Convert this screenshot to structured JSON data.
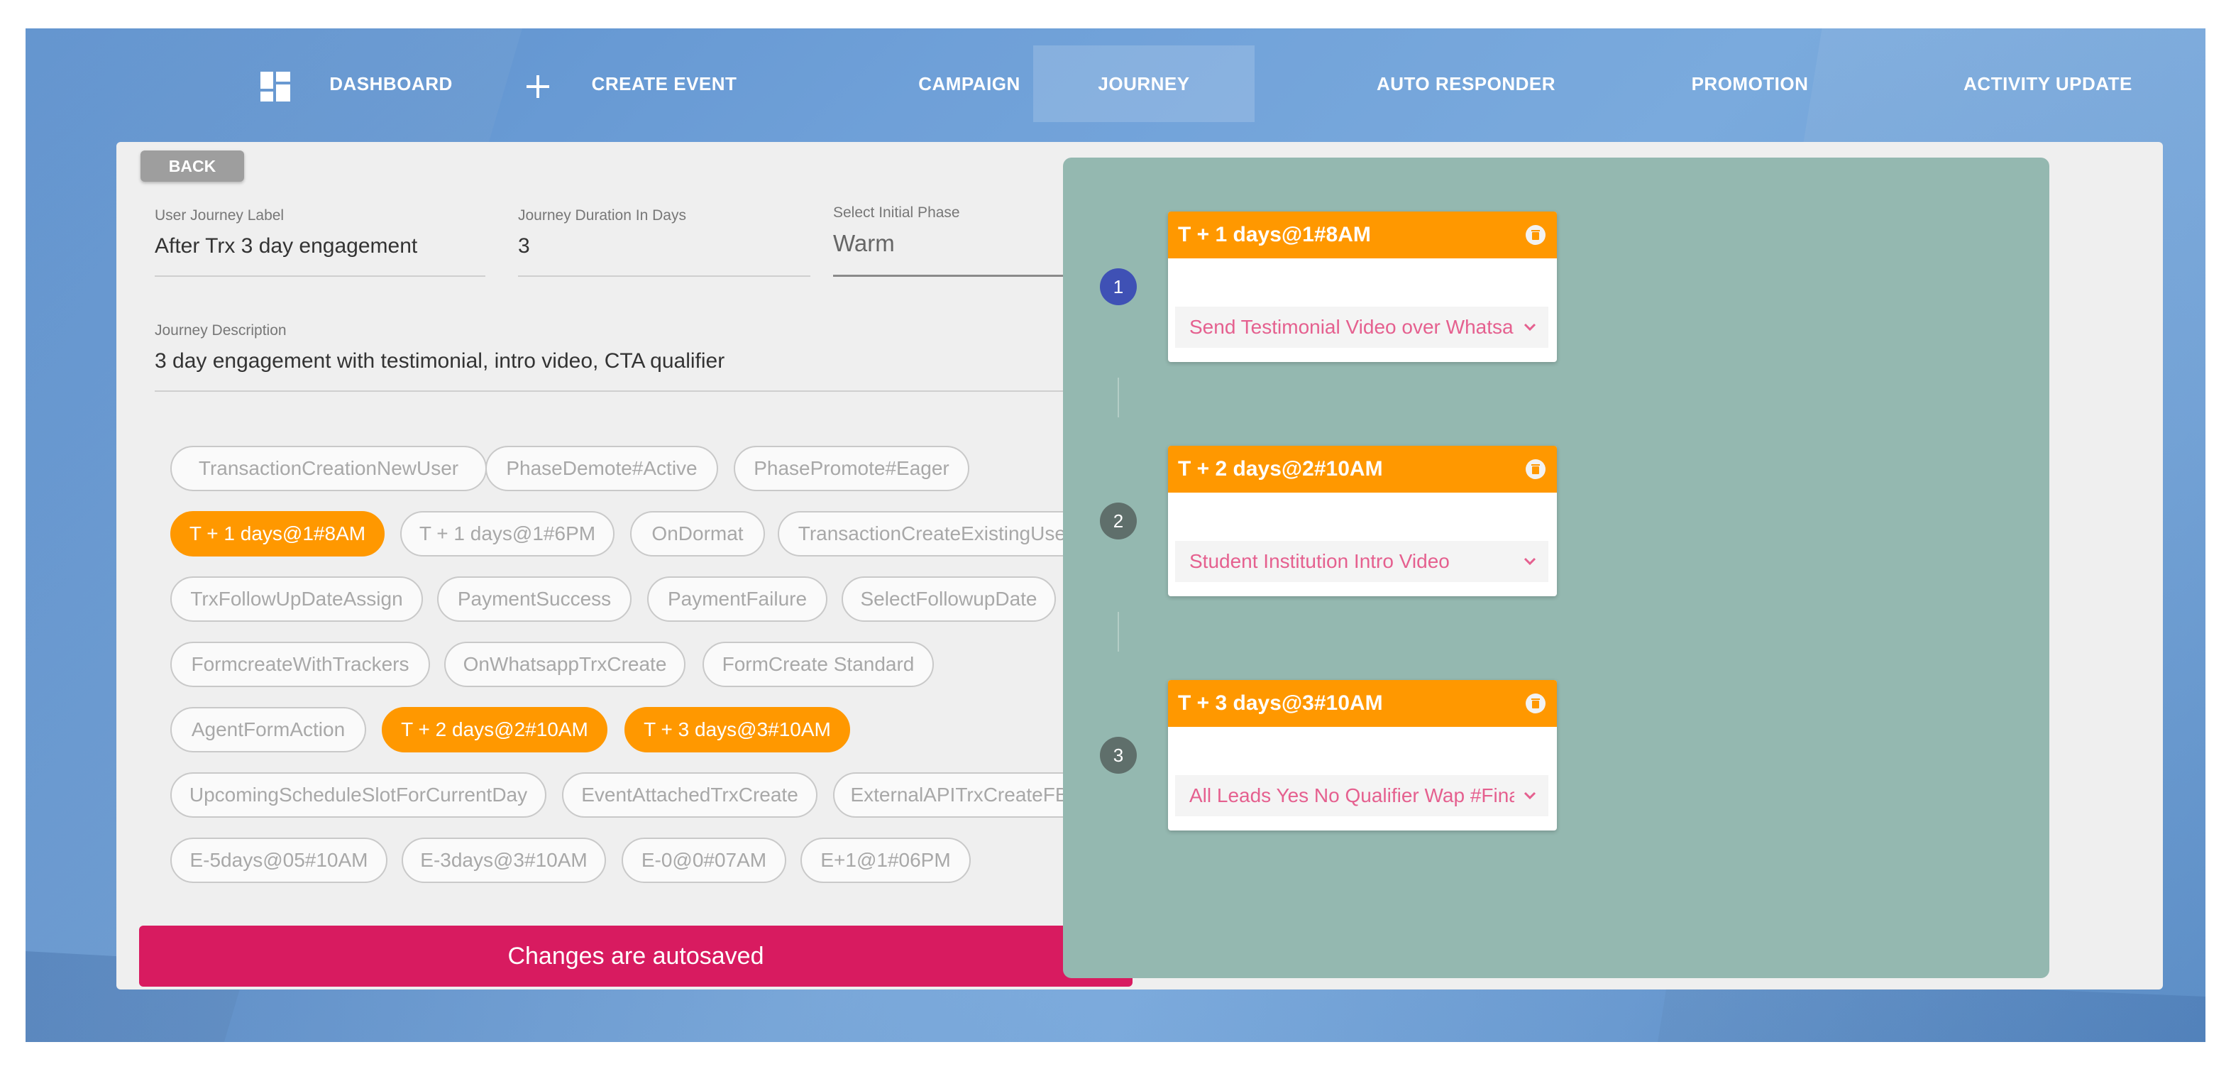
{
  "nav": {
    "items": [
      {
        "key": "dashboard",
        "label": "DASHBOARD",
        "icon": "dashboard-grid-icon"
      },
      {
        "key": "create-event",
        "label": "CREATE EVENT",
        "icon": "plus-icon"
      },
      {
        "key": "campaign",
        "label": "CAMPAIGN"
      },
      {
        "key": "journey",
        "label": "JOURNEY",
        "active": true
      },
      {
        "key": "auto-responder",
        "label": "AUTO RESPONDER"
      },
      {
        "key": "promotion",
        "label": "PROMOTION"
      },
      {
        "key": "activity-update",
        "label": "ACTIVITY UPDATE"
      }
    ]
  },
  "form": {
    "back_label": "BACK",
    "journey_label": {
      "label": "User Journey Label",
      "value": "After Trx 3 day engagement"
    },
    "duration": {
      "label": "Journey Duration In Days",
      "value": "3"
    },
    "initial_phase": {
      "label": "Select Initial Phase",
      "value": "Warm"
    },
    "description": {
      "label": "Journey Description",
      "value": "3 day engagement with testimonial, intro video, CTA qualifier"
    },
    "chips": [
      {
        "label": "TransactionCreationNewUser",
        "selected": false
      },
      {
        "label": "PhaseDemote#Active",
        "selected": false
      },
      {
        "label": "PhasePromote#Eager",
        "selected": false
      },
      {
        "label": "T + 1 days@1#8AM",
        "selected": true
      },
      {
        "label": "T + 1 days@1#6PM",
        "selected": false
      },
      {
        "label": "OnDormat",
        "selected": false
      },
      {
        "label": "TransactionCreateExistingUser",
        "selected": false
      },
      {
        "label": "TrxFollowUpDateAssign",
        "selected": false
      },
      {
        "label": "PaymentSuccess",
        "selected": false
      },
      {
        "label": "PaymentFailure",
        "selected": false
      },
      {
        "label": "SelectFollowupDate",
        "selected": false
      },
      {
        "label": "FormcreateWithTrackers",
        "selected": false
      },
      {
        "label": "OnWhatsappTrxCreate",
        "selected": false
      },
      {
        "label": "FormCreate Standard",
        "selected": false
      },
      {
        "label": "AgentFormAction",
        "selected": false
      },
      {
        "label": "T + 2 days@2#10AM",
        "selected": true
      },
      {
        "label": "T + 3 days@3#10AM",
        "selected": true
      },
      {
        "label": "UpcomingScheduleSlotForCurrentDay",
        "selected": false
      },
      {
        "label": "EventAttachedTrxCreate",
        "selected": false
      },
      {
        "label": "ExternalAPITrxCreateFB",
        "selected": false
      },
      {
        "label": "E-5days@05#10AM",
        "selected": false
      },
      {
        "label": "E-3days@3#10AM",
        "selected": false
      },
      {
        "label": "E-0@0#07AM",
        "selected": false
      },
      {
        "label": "E+1@1#06PM",
        "selected": false
      }
    ],
    "autosave_label": "Changes are autosaved"
  },
  "journey": {
    "steps": [
      {
        "number": "1",
        "title": "T + 1 days@1#8AM",
        "action": "Send Testimonial Video over Whatsapp",
        "number_color": "#3f51b5"
      },
      {
        "number": "2",
        "title": "T + 2 days@2#10AM",
        "action": "Student Institution Intro Video",
        "number_color": "#5f6f6b"
      },
      {
        "number": "3",
        "title": "T + 3 days@3#10AM",
        "action": "All Leads Yes No Qualifier Wap #Final",
        "number_color": "#5f6f6b"
      }
    ]
  },
  "colors": {
    "accent_orange": "#ff9800",
    "autosave_pink": "#d81b60",
    "canvas_green": "#94b8b0",
    "nav_blue": "#6fa0d8"
  }
}
